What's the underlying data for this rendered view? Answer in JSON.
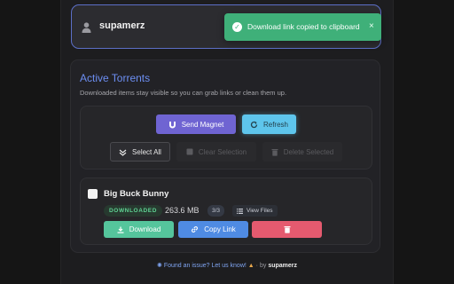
{
  "user": {
    "name": "supamerz"
  },
  "toast": {
    "message": "Download link copied to clipboard",
    "close": "×"
  },
  "panel": {
    "title": "Active Torrents",
    "subtitle": "Downloaded items stay visible so you can grab links or clean them up."
  },
  "actions": {
    "send_magnet": "Send Magnet",
    "refresh": "Refresh",
    "select_all": "Select All",
    "clear_selection": "Clear Selection",
    "delete_selected": "Delete Selected"
  },
  "torrent": {
    "name": "Big Buck Bunny",
    "status": "DOWNLOADED",
    "size": "263.6 MB",
    "files_count": "3/3",
    "view_files": "View Files",
    "download": "Download",
    "copy_link": "Copy Link"
  },
  "footer": {
    "issue_text": "Found an issue? Let us know!",
    "by": "by",
    "author": "supamerz"
  },
  "colors": {
    "accent": "#6c8ef2",
    "toast": "#3fb079",
    "magnet": "#6f64d2",
    "refresh": "#5ec5ec",
    "download": "#55c59c",
    "copy": "#4f8be3",
    "delete": "#e55a6f"
  }
}
